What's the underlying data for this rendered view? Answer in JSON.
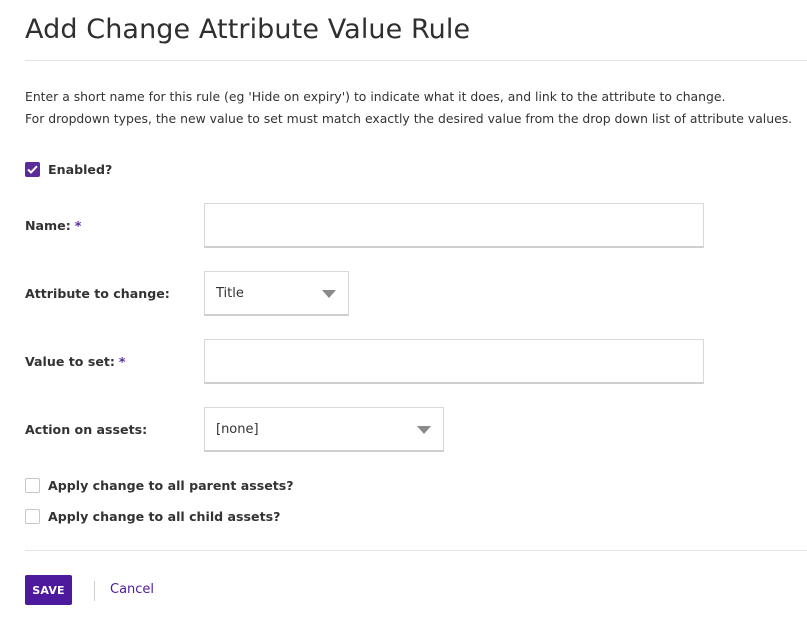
{
  "page": {
    "title": "Add Change Attribute Value Rule",
    "intro_line1": "Enter a short name for this rule (eg 'Hide on expiry') to indicate what it does, and link to the attribute to change.",
    "intro_line2": "For dropdown types, the new value to set must match exactly the desired value from the drop down list of attribute values."
  },
  "form": {
    "enabled": {
      "label": "Enabled?",
      "checked": true
    },
    "name": {
      "label": "Name:",
      "required_mark": "*",
      "value": "",
      "placeholder": ""
    },
    "attribute": {
      "label": "Attribute to change:",
      "selected": "Title"
    },
    "value_to_set": {
      "label": "Value to set:",
      "required_mark": "*",
      "value": "",
      "placeholder": ""
    },
    "action": {
      "label": "Action on assets:",
      "selected": "[none]"
    },
    "apply_parent": {
      "label": "Apply change to all parent assets?",
      "checked": false
    },
    "apply_child": {
      "label": "Apply change to all child assets?",
      "checked": false
    }
  },
  "actions": {
    "save_label": "SAVE",
    "cancel_label": "Cancel"
  },
  "colors": {
    "accent": "#4d1a9e",
    "check": "#5b2a9b"
  }
}
